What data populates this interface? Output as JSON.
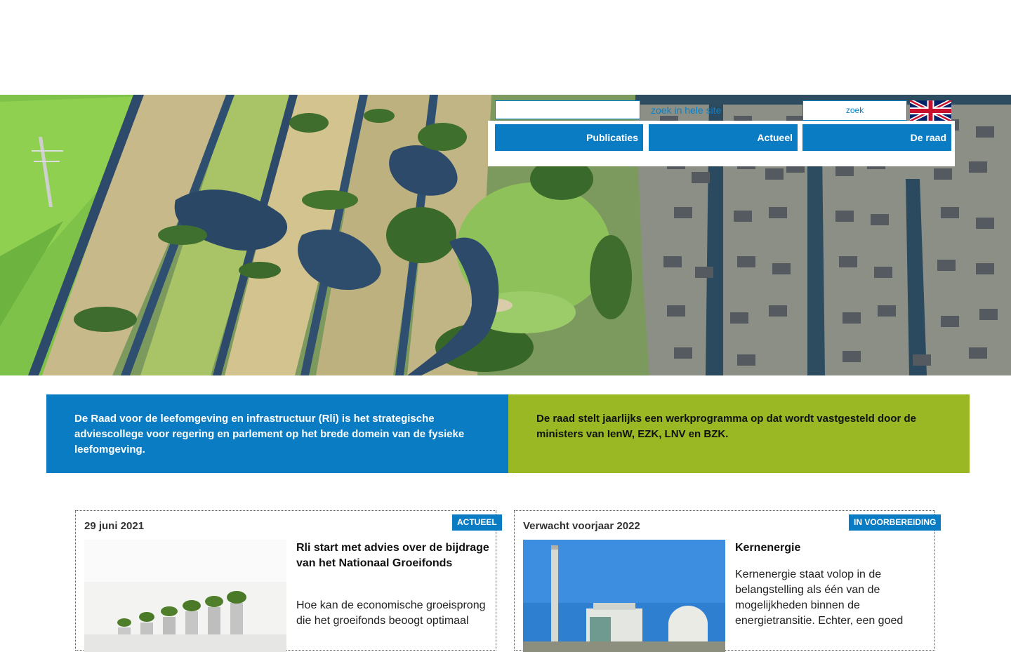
{
  "header": {
    "search": {
      "value": "",
      "placeholder": "zoek in hele site",
      "button_label": "zoek"
    },
    "language_flag_icon": "flag-uk-icon",
    "nav": [
      {
        "label": "Publicaties"
      },
      {
        "label": "Actueel"
      },
      {
        "label": "De raad"
      }
    ]
  },
  "intro": {
    "left": "De Raad voor de leefomgeving en infrastructuur (Rli) is het strategische adviescollege voor regering en parlement op het brede domein van de fysieke leefomgeving.",
    "right": "De raad stelt jaarlijks een werkprogramma op dat wordt vastgesteld door de ministers van IenW, EZK, LNV en BZK."
  },
  "cards": [
    {
      "date": "29 juni 2021",
      "badge": "ACTUEEL",
      "title": "Rli start met advies over de bijdrage van het Nationaal Groeifonds",
      "text": "Hoe kan de economische groeisprong die het groeifonds beoogt optimaal"
    },
    {
      "date": "Verwacht voorjaar 2022",
      "badge": "IN VOORBEREIDING",
      "title": "Kernenergie",
      "text": "Kernenergie staat volop in de belangstelling als één van de mogelijkheden binnen de energietransitie. Echter, een goed"
    }
  ],
  "colors": {
    "brand_blue": "#0a7cc4",
    "brand_green": "#9ab823"
  }
}
